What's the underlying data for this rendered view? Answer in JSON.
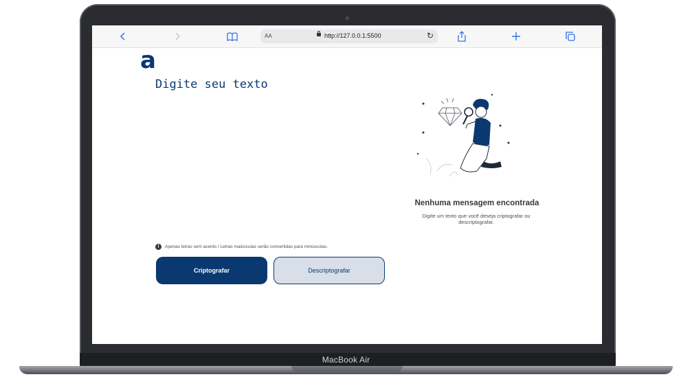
{
  "device": {
    "model_label": "MacBook Air"
  },
  "browser": {
    "url": "http://127.0.0.1:5500",
    "reader_label": "AA",
    "back_icon": "chevron-left-icon",
    "forward_icon": "chevron-right-icon",
    "bookmarks_icon": "book-icon",
    "reload_icon": "reload-icon",
    "share_icon": "share-icon",
    "new_tab_icon": "plus-icon",
    "tabs_icon": "tabs-icon"
  },
  "app": {
    "logo": "a",
    "input_placeholder": "Digite seu texto",
    "hint": "Apenas letras sem acento / Letras maiúsculas serão convertidas para minúsculas.",
    "buttons": {
      "encrypt": "Criptografar",
      "decrypt": "Descriptografar"
    },
    "empty_state": {
      "title": "Nenhuma mensagem encontrada",
      "description": "Digite um texto que você deseja criptografar ou descriptografar."
    }
  },
  "colors": {
    "primary": "#0A3871",
    "secondary_bg": "#D8DFE8",
    "browser_accent": "#2F72E8"
  }
}
